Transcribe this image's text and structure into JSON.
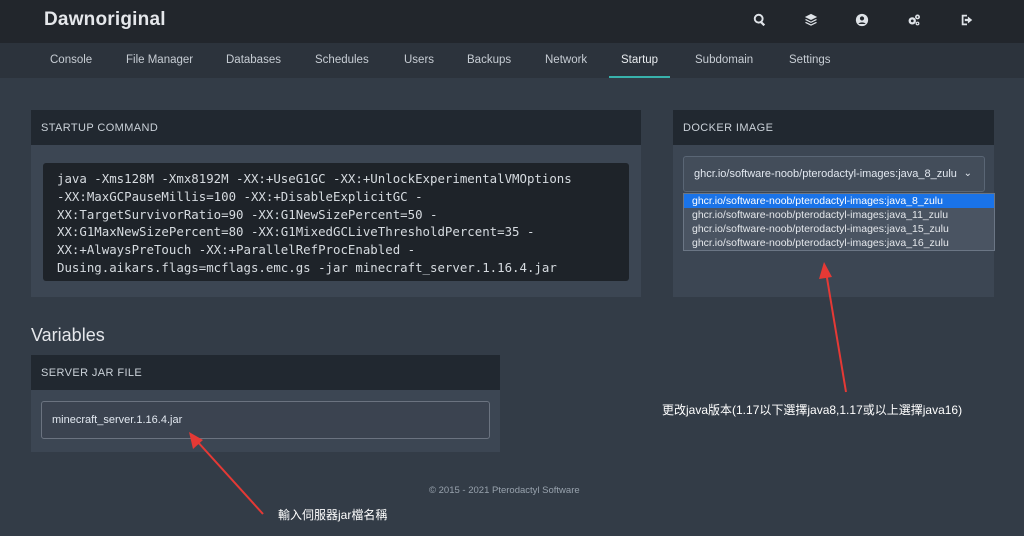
{
  "app": {
    "title": "Dawnoriginal"
  },
  "top_icons": [
    "search-icon",
    "layers-icon",
    "account-icon",
    "cogs-icon",
    "sign-out-icon"
  ],
  "nav": {
    "items": [
      "Console",
      "File Manager",
      "Databases",
      "Schedules",
      "Users",
      "Backups",
      "Network",
      "Startup",
      "Subdomain",
      "Settings"
    ],
    "active": "Startup",
    "external_icon": "external-link-icon"
  },
  "startup": {
    "header": "STARTUP COMMAND",
    "command_lines": [
      "java -Xms128M -Xmx8192M -XX:+UseG1GC -XX:+UnlockExperimentalVMOptions",
      "-XX:MaxGCPauseMillis=100 -XX:+DisableExplicitGC -",
      "XX:TargetSurvivorRatio=90 -XX:G1NewSizePercent=50 -",
      "XX:G1MaxNewSizePercent=80 -XX:G1MixedGCLiveThresholdPercent=35 -",
      "XX:+AlwaysPreTouch -XX:+ParallelRefProcEnabled -",
      "Dusing.aikars.flags=mcflags.emc.gs -jar minecraft_server.1.16.4.jar"
    ]
  },
  "docker": {
    "header": "DOCKER IMAGE",
    "selected": "ghcr.io/software-noob/pterodactyl-images:java_8_zulu",
    "options": [
      "ghcr.io/software-noob/pterodactyl-images:java_8_zulu",
      "ghcr.io/software-noob/pterodactyl-images:java_11_zulu",
      "ghcr.io/software-noob/pterodactyl-images:java_15_zulu",
      "ghcr.io/software-noob/pterodactyl-images:java_16_zulu"
    ]
  },
  "variables": {
    "title": "Variables",
    "server_jar": {
      "header": "SERVER JAR FILE",
      "value": "minecraft_server.1.16.4.jar"
    }
  },
  "footer": "© 2015 - 2021 Pterodactyl Software",
  "annotations": {
    "docker_note": "更改java版本(1.17以下選擇java8,1.17或以上選擇java16)",
    "jar_note": "輸入伺服器jar檔名稱",
    "arrow_color": "#e53935"
  }
}
